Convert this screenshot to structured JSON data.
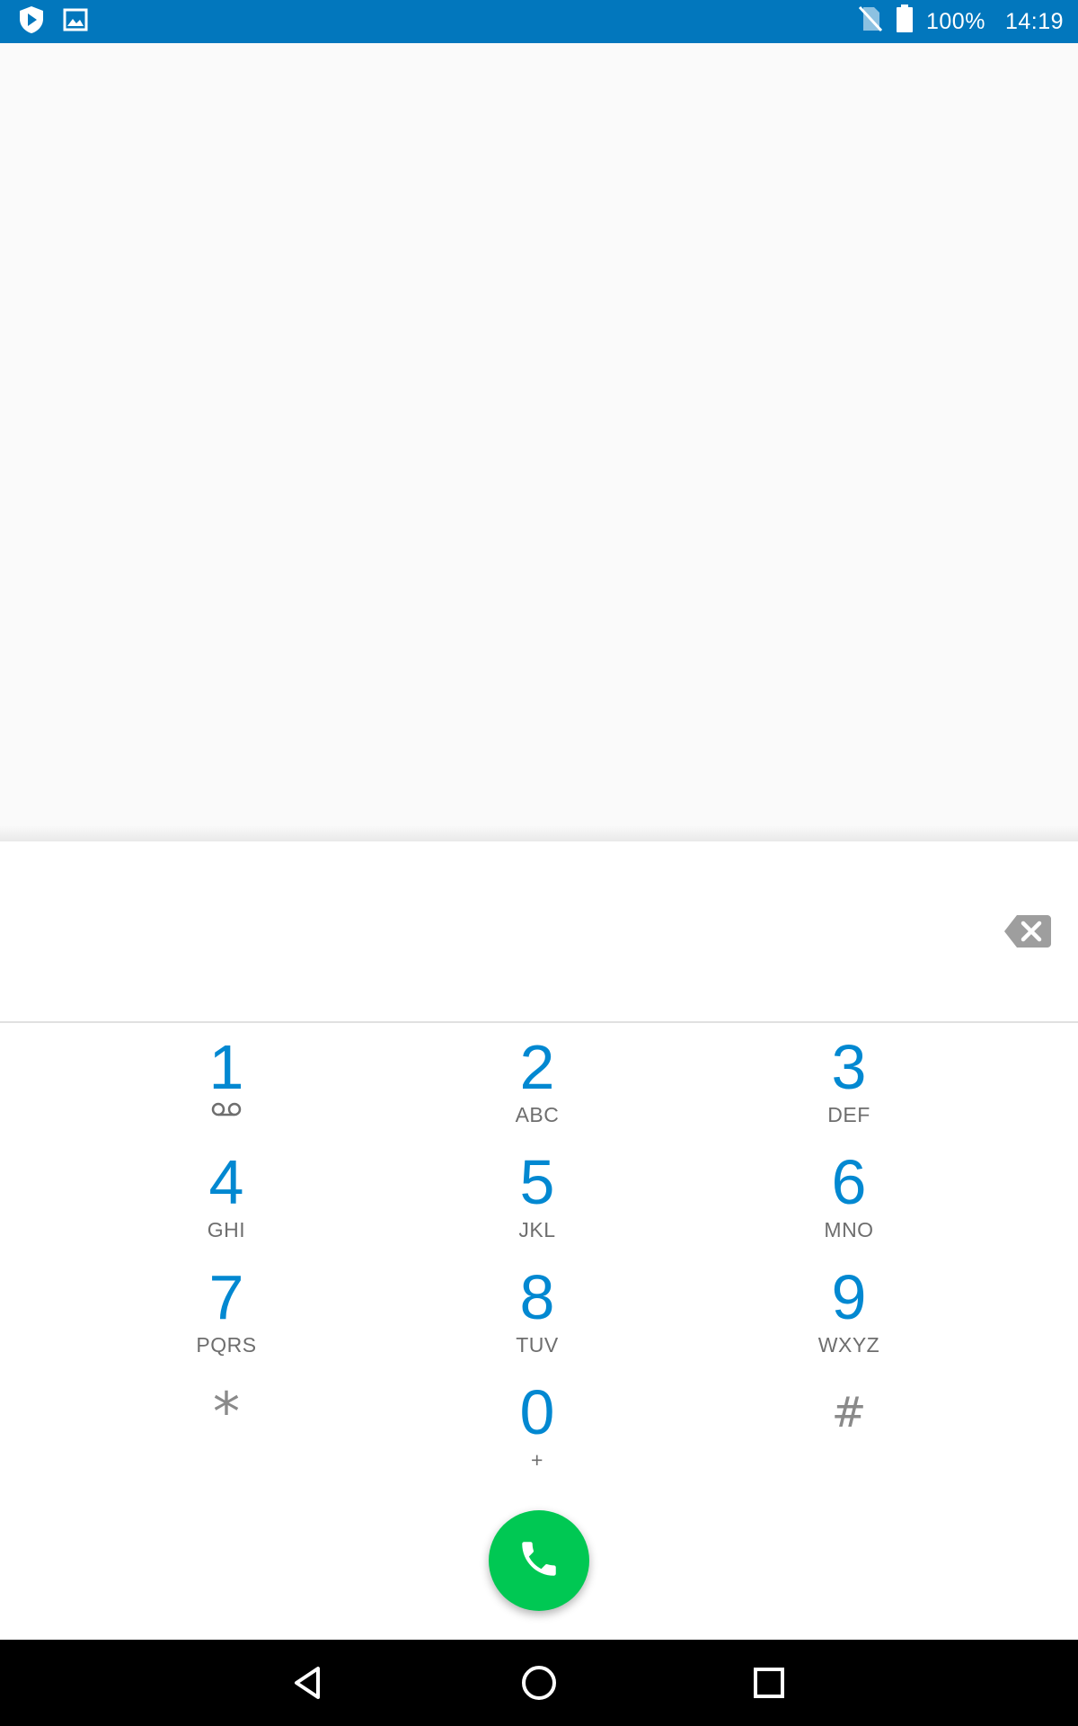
{
  "status_bar": {
    "battery_text": "100%",
    "time": "14:19",
    "left_icons": [
      "shield-play-icon",
      "image-icon"
    ],
    "right_icons": [
      "no-sim-icon",
      "battery-icon"
    ],
    "color": "#0277bd"
  },
  "dialer": {
    "input_value": "",
    "keys": [
      {
        "digit": "1",
        "letters": "",
        "sub_icon": "voicemail-icon"
      },
      {
        "digit": "2",
        "letters": "ABC"
      },
      {
        "digit": "3",
        "letters": "DEF"
      },
      {
        "digit": "4",
        "letters": "GHI"
      },
      {
        "digit": "5",
        "letters": "JKL"
      },
      {
        "digit": "6",
        "letters": "MNO"
      },
      {
        "digit": "7",
        "letters": "PQRS"
      },
      {
        "digit": "8",
        "letters": "TUV"
      },
      {
        "digit": "9",
        "letters": "WXYZ"
      },
      {
        "digit": "*",
        "letters": ""
      },
      {
        "digit": "0",
        "letters": "+"
      },
      {
        "digit": "#",
        "letters": ""
      }
    ],
    "digit_color": "#0288d1",
    "call_button_color": "#00c853"
  },
  "nav_bar": {
    "buttons": [
      "back-icon",
      "home-icon",
      "recents-icon"
    ]
  }
}
